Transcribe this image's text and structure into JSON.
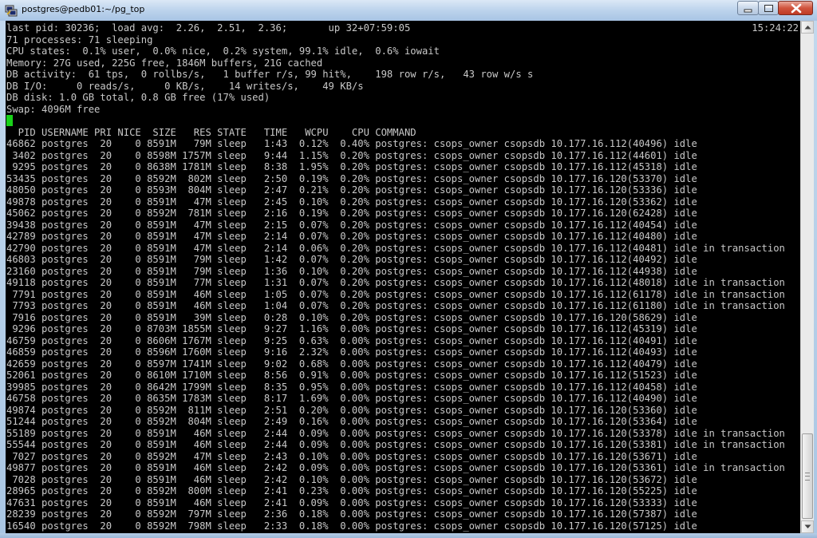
{
  "window": {
    "title": "postgres@pedb01:~/pg_top"
  },
  "icons": {
    "app": "putty-icon",
    "minimize": "minimize-icon",
    "maximize": "maximize-icon",
    "close": "close-icon",
    "scroll_up": "arrow-up-icon",
    "scroll_down": "arrow-down-icon"
  },
  "colors": {
    "terminal_bg": "#000000",
    "terminal_fg": "#c8c8c8",
    "cursor": "#19d219",
    "close_button": "#c8452f"
  },
  "terminal": {
    "clock": "15:24:22",
    "header": [
      "last pid: 30236;  load avg:  2.26,  2.51,  2.36;       up 32+07:59:05",
      "71 processes: 71 sleeping",
      "CPU states:  0.1% user,  0.0% nice,  0.2% system, 99.1% idle,  0.6% iowait",
      "Memory: 27G used, 225G free, 1846M buffers, 21G cached",
      "DB activity:  61 tps,  0 rollbs/s,   1 buffer r/s, 99 hit%,    198 row r/s,   43 row w/s s",
      "DB I/O:     0 reads/s,     0 KB/s,    14 writes/s,    49 KB/s",
      "DB disk: 1.0 GB total, 0.8 GB free (17% used)",
      "Swap: 4096M free"
    ],
    "column_header": "  PID USERNAME PRI NICE  SIZE   RES STATE   TIME   WCPU    CPU COMMAND",
    "rows": [
      "46862 postgres  20    0 8591M   79M sleep   1:43  0.12%  0.40% postgres: csops_owner csopsdb 10.177.16.112(40496) idle",
      " 3402 postgres  20    0 8598M 1757M sleep   9:44  1.15%  0.20% postgres: csops_owner csopsdb 10.177.16.112(44601) idle",
      " 9295 postgres  20    0 8638M 1781M sleep   8:38  1.95%  0.20% postgres: csops_owner csopsdb 10.177.16.112(45318) idle",
      "53435 postgres  20    0 8592M  802M sleep   2:50  0.19%  0.20% postgres: csops_owner csopsdb 10.177.16.120(53370) idle",
      "48050 postgres  20    0 8593M  804M sleep   2:47  0.21%  0.20% postgres: csops_owner csopsdb 10.177.16.120(53336) idle",
      "49878 postgres  20    0 8591M   47M sleep   2:45  0.10%  0.20% postgres: csops_owner csopsdb 10.177.16.120(53362) idle",
      "45062 postgres  20    0 8592M  781M sleep   2:16  0.19%  0.20% postgres: csops_owner csopsdb 10.177.16.120(62428) idle",
      "39438 postgres  20    0 8591M   47M sleep   2:15  0.07%  0.20% postgres: csops_owner csopsdb 10.177.16.112(40454) idle",
      "42789 postgres  20    0 8591M   47M sleep   2:14  0.07%  0.20% postgres: csops_owner csopsdb 10.177.16.112(40480) idle",
      "42790 postgres  20    0 8591M   47M sleep   2:14  0.06%  0.20% postgres: csops_owner csopsdb 10.177.16.112(40481) idle in transaction",
      "46803 postgres  20    0 8591M   79M sleep   1:42  0.07%  0.20% postgres: csops_owner csopsdb 10.177.16.112(40492) idle",
      "23160 postgres  20    0 8591M   79M sleep   1:36  0.10%  0.20% postgres: csops_owner csopsdb 10.177.16.112(44938) idle",
      "49118 postgres  20    0 8591M   77M sleep   1:31  0.07%  0.20% postgres: csops_owner csopsdb 10.177.16.112(48018) idle in transaction",
      " 7791 postgres  20    0 8591M   46M sleep   1:05  0.07%  0.20% postgres: csops_owner csopsdb 10.177.16.112(61178) idle in transaction",
      " 7793 postgres  20    0 8591M   46M sleep   1:04  0.07%  0.20% postgres: csops_owner csopsdb 10.177.16.112(61180) idle in transaction",
      " 7916 postgres  20    0 8591M   39M sleep   0:28  0.10%  0.20% postgres: csops_owner csopsdb 10.177.16.120(58629) idle",
      " 9296 postgres  20    0 8703M 1855M sleep   9:27  1.16%  0.00% postgres: csops_owner csopsdb 10.177.16.112(45319) idle",
      "46759 postgres  20    0 8606M 1767M sleep   9:25  0.63%  0.00% postgres: csops_owner csopsdb 10.177.16.112(40491) idle",
      "46859 postgres  20    0 8596M 1760M sleep   9:16  2.32%  0.00% postgres: csops_owner csopsdb 10.177.16.112(40493) idle",
      "42659 postgres  20    0 8597M 1741M sleep   9:02  0.68%  0.00% postgres: csops_owner csopsdb 10.177.16.112(40479) idle",
      "52061 postgres  20    0 8610M 1710M sleep   8:56  0.91%  0.00% postgres: csops_owner csopsdb 10.177.16.112(51523) idle",
      "39985 postgres  20    0 8642M 1799M sleep   8:35  0.95%  0.00% postgres: csops_owner csopsdb 10.177.16.112(40458) idle",
      "46758 postgres  20    0 8635M 1783M sleep   8:17  1.69%  0.00% postgres: csops_owner csopsdb 10.177.16.112(40490) idle",
      "49874 postgres  20    0 8592M  811M sleep   2:51  0.20%  0.00% postgres: csops_owner csopsdb 10.177.16.120(53360) idle",
      "51244 postgres  20    0 8592M  804M sleep   2:49  0.16%  0.00% postgres: csops_owner csopsdb 10.177.16.120(53364) idle",
      "55189 postgres  20    0 8591M   46M sleep   2:44  0.09%  0.00% postgres: csops_owner csopsdb 10.177.16.120(53378) idle in transaction",
      "55544 postgres  20    0 8591M   46M sleep   2:44  0.09%  0.00% postgres: csops_owner csopsdb 10.177.16.120(53381) idle in transaction",
      " 7027 postgres  20    0 8592M   47M sleep   2:43  0.10%  0.00% postgres: csops_owner csopsdb 10.177.16.120(53671) idle",
      "49877 postgres  20    0 8591M   46M sleep   2:42  0.09%  0.00% postgres: csops_owner csopsdb 10.177.16.120(53361) idle in transaction",
      " 7028 postgres  20    0 8591M   46M sleep   2:42  0.10%  0.00% postgres: csops_owner csopsdb 10.177.16.120(53672) idle",
      "28965 postgres  20    0 8592M  800M sleep   2:41  0.23%  0.00% postgres: csops_owner csopsdb 10.177.16.120(55225) idle",
      "47631 postgres  20    0 8591M   46M sleep   2:41  0.09%  0.00% postgres: csops_owner csopsdb 10.177.16.120(53333) idle",
      "28239 postgres  20    0 8592M  797M sleep   2:36  0.18%  0.00% postgres: csops_owner csopsdb 10.177.16.120(57387) idle",
      "16540 postgres  20    0 8592M  798M sleep   2:33  0.18%  0.00% postgres: csops_owner csopsdb 10.177.16.120(57125) idle"
    ]
  }
}
